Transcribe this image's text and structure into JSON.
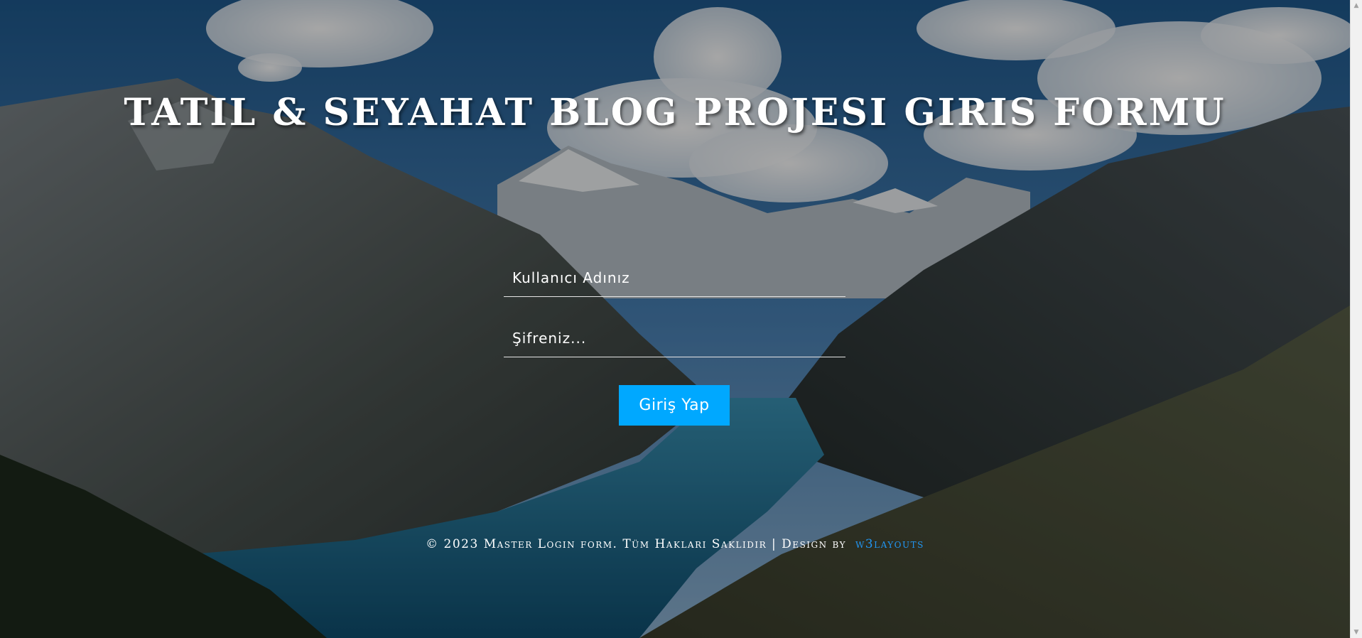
{
  "header": {
    "title": "TATIL & SEYAHAT BLOG PROJESI GIRIS FORMU"
  },
  "login_form": {
    "username_placeholder": "Kullanıcı Adınız",
    "password_placeholder": "Şifreniz...",
    "submit_label": "Giriş Yap",
    "accent_color": "#00a8ff"
  },
  "footer": {
    "text": "© 2023 Master Login form. Tüm Hakları Saklıdır | Design by",
    "link_text": "w3layouts",
    "link_color": "#2196f3"
  },
  "background": {
    "description_icon": "mountain-lake-photo-icon"
  }
}
